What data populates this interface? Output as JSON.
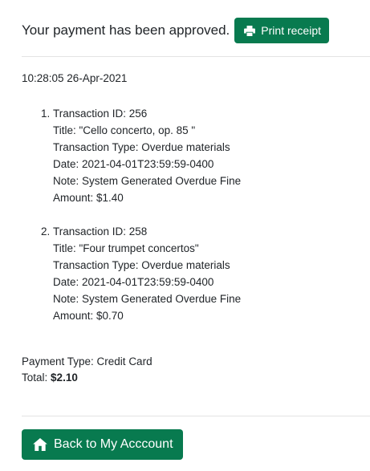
{
  "header": {
    "message": "Your payment has been approved.",
    "print_label": "Print receipt"
  },
  "timestamp": "10:28:05 26-Apr-2021",
  "transactions": [
    {
      "number": "1.",
      "id_line": "Transaction ID: 256",
      "title_line": "Title: \"Cello concerto, op. 85 \"",
      "type_line": "Transaction Type: Overdue materials",
      "date_line": "Date: 2021-04-01T23:59:59-0400",
      "note_line": "Note: System Generated Overdue Fine",
      "amount_line": "Amount: $1.40"
    },
    {
      "number": "2.",
      "id_line": "Transaction ID: 258",
      "title_line": "Title: \"Four trumpet concertos\"",
      "type_line": "Transaction Type: Overdue materials",
      "date_line": "Date: 2021-04-01T23:59:59-0400",
      "note_line": "Note: System Generated Overdue Fine",
      "amount_line": "Amount: $0.70"
    }
  ],
  "summary": {
    "payment_type": "Payment Type: Credit Card",
    "total_label": "Total:",
    "total_value": "$2.10"
  },
  "footer": {
    "back_label": "Back to My Acccount"
  },
  "colors": {
    "button_green": "#087a4f"
  },
  "icons": {
    "print": "printer-icon",
    "back": "home-icon"
  }
}
